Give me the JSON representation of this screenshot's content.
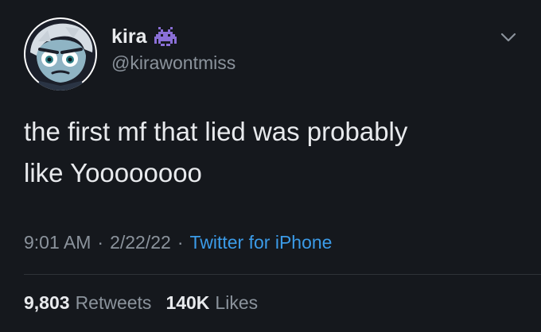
{
  "author": {
    "display_name": "kira",
    "name_emoji": "alien-monster-icon",
    "handle": "@kirawontmiss",
    "avatar": "cartoon-avatar"
  },
  "tweet": {
    "text": "the first mf that lied was probably\nlike Yoooooooo"
  },
  "meta": {
    "time": "9:01 AM",
    "separator": "·",
    "date": "2/22/22",
    "source": "Twitter for iPhone"
  },
  "stats": {
    "retweets_count": "9,803",
    "retweets_label": "Retweets",
    "likes_count": "140K",
    "likes_label": "Likes"
  },
  "colors": {
    "background": "#15181d",
    "text": "#e8eaed",
    "muted": "#8b939c",
    "link": "#3b9be8",
    "emoji": "#8a6fd6"
  },
  "icons": {
    "more": "chevron-down-icon"
  }
}
